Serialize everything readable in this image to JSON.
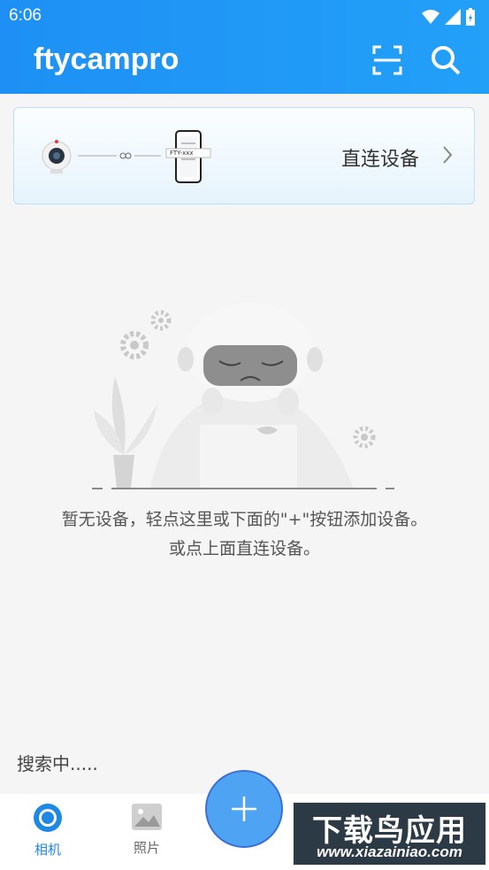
{
  "status": {
    "time": "6:06"
  },
  "header": {
    "title": "ftycampro",
    "scan_icon": "scan-icon",
    "search_icon": "search-icon"
  },
  "direct_card": {
    "label": "直连设备",
    "device_tag": "FTY-xxx"
  },
  "empty_state": {
    "line1": "暂无设备，轻点这里或下面的\"+\"按钮添加设备。",
    "line2": "或点上面直连设备。"
  },
  "searching": "搜索中.....",
  "bottom_nav": {
    "items": [
      {
        "label": "相机",
        "icon": "camera-icon",
        "active": true
      },
      {
        "label": "照片",
        "icon": "photo-icon",
        "active": false
      }
    ]
  },
  "fab": {
    "icon": "plus-icon"
  },
  "watermark": {
    "main": "下载鸟应用",
    "sub": "www.xiazainiao.com"
  },
  "colors": {
    "primary": "#1e90f5",
    "active_nav": "#1e88e5",
    "inactive_nav": "#666666"
  }
}
